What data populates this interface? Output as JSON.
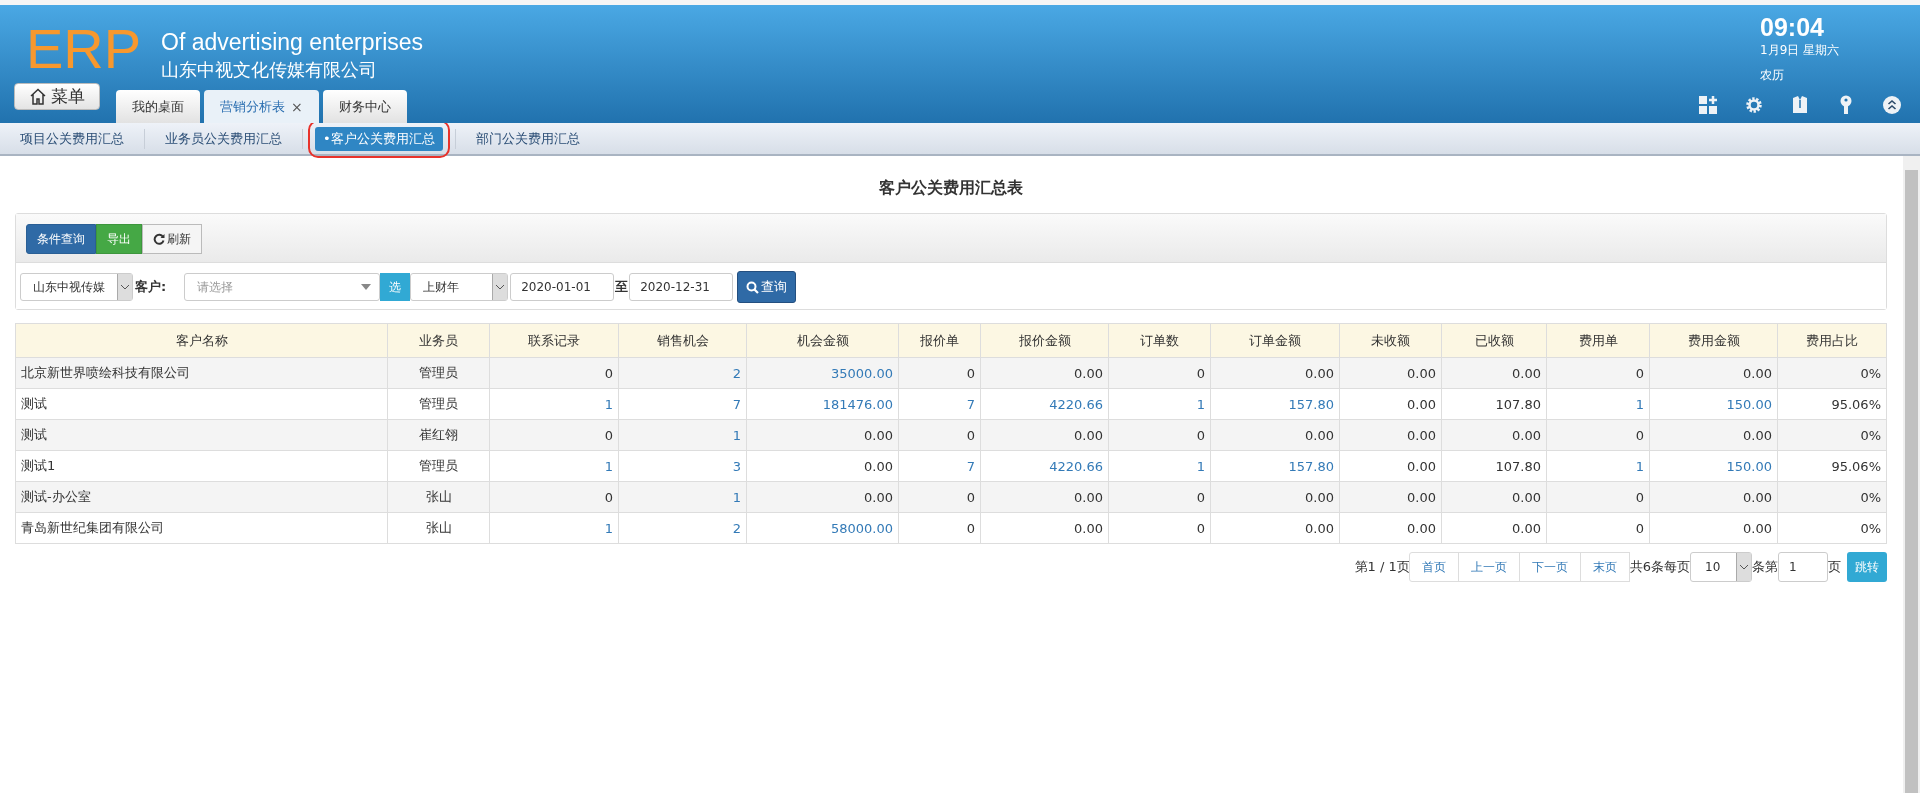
{
  "header": {
    "logo": "ERP",
    "title": "Of advertising enterprises",
    "company": "山东中视文化传媒有限公司",
    "menu_button": "菜单",
    "time": "09:04",
    "date": "1月9日 星期六",
    "lunar": "农历"
  },
  "tabs": [
    {
      "label": "我的桌面",
      "selected": false,
      "closable": false
    },
    {
      "label": "营销分析表",
      "selected": true,
      "closable": true,
      "close": "×"
    },
    {
      "label": "财务中心",
      "selected": false,
      "closable": false
    }
  ],
  "subtabs": [
    {
      "label": "项目公关费用汇总",
      "selected": false
    },
    {
      "label": "业务员公关费用汇总",
      "selected": false
    },
    {
      "label": "•客户公关费用汇总",
      "selected": true
    },
    {
      "label": "部门公关费用汇总",
      "selected": false
    }
  ],
  "page_title": "客户公关费用汇总表",
  "toolbar": [
    {
      "label": "条件查询",
      "kind": "primary"
    },
    {
      "label": "导出",
      "kind": "success"
    },
    {
      "label": "刷新",
      "kind": "refresh"
    }
  ],
  "filters": {
    "company": "山东中视传媒",
    "customer_label": "客户:",
    "customer_placeholder": "请选择",
    "pick_button": "选",
    "period": "上财年",
    "date_from": "2020-01-01",
    "to_label": "至",
    "date_to": "2020-12-31",
    "query_button": "查询"
  },
  "table": {
    "columns": [
      "客户名称",
      "业务员",
      "联系记录",
      "销售机会",
      "机会金额",
      "报价单",
      "报价金额",
      "订单数",
      "订单金额",
      "未收额",
      "已收额",
      "费用单",
      "费用金额",
      "费用占比"
    ],
    "rows": [
      [
        {
          "text": "北京新世界喷绘科技有限公司",
          "link": false
        },
        {
          "text": "管理员",
          "link": false
        },
        {
          "text": "0",
          "link": false
        },
        {
          "text": "2",
          "link": true
        },
        {
          "text": "35000.00",
          "link": true
        },
        {
          "text": "0",
          "link": false
        },
        {
          "text": "0.00",
          "link": false
        },
        {
          "text": "0",
          "link": false
        },
        {
          "text": "0.00",
          "link": false
        },
        {
          "text": "0.00",
          "link": false
        },
        {
          "text": "0.00",
          "link": false
        },
        {
          "text": "0",
          "link": false
        },
        {
          "text": "0.00",
          "link": false
        },
        {
          "text": "0%",
          "link": false
        }
      ],
      [
        {
          "text": "测试",
          "link": false
        },
        {
          "text": "管理员",
          "link": false
        },
        {
          "text": "1",
          "link": true
        },
        {
          "text": "7",
          "link": true
        },
        {
          "text": "181476.00",
          "link": true
        },
        {
          "text": "7",
          "link": true
        },
        {
          "text": "4220.66",
          "link": true
        },
        {
          "text": "1",
          "link": true
        },
        {
          "text": "157.80",
          "link": true
        },
        {
          "text": "0.00",
          "link": false
        },
        {
          "text": "107.80",
          "link": false
        },
        {
          "text": "1",
          "link": true
        },
        {
          "text": "150.00",
          "link": true
        },
        {
          "text": "95.06%",
          "link": false
        }
      ],
      [
        {
          "text": "测试",
          "link": false
        },
        {
          "text": "崔红翎",
          "link": false
        },
        {
          "text": "0",
          "link": false
        },
        {
          "text": "1",
          "link": true
        },
        {
          "text": "0.00",
          "link": false
        },
        {
          "text": "0",
          "link": false
        },
        {
          "text": "0.00",
          "link": false
        },
        {
          "text": "0",
          "link": false
        },
        {
          "text": "0.00",
          "link": false
        },
        {
          "text": "0.00",
          "link": false
        },
        {
          "text": "0.00",
          "link": false
        },
        {
          "text": "0",
          "link": false
        },
        {
          "text": "0.00",
          "link": false
        },
        {
          "text": "0%",
          "link": false
        }
      ],
      [
        {
          "text": "测试1",
          "link": false
        },
        {
          "text": "管理员",
          "link": false
        },
        {
          "text": "1",
          "link": true
        },
        {
          "text": "3",
          "link": true
        },
        {
          "text": "0.00",
          "link": false
        },
        {
          "text": "7",
          "link": true
        },
        {
          "text": "4220.66",
          "link": true
        },
        {
          "text": "1",
          "link": true
        },
        {
          "text": "157.80",
          "link": true
        },
        {
          "text": "0.00",
          "link": false
        },
        {
          "text": "107.80",
          "link": false
        },
        {
          "text": "1",
          "link": true
        },
        {
          "text": "150.00",
          "link": true
        },
        {
          "text": "95.06%",
          "link": false
        }
      ],
      [
        {
          "text": "测试-办公室",
          "link": false
        },
        {
          "text": "张山",
          "link": false
        },
        {
          "text": "0",
          "link": false
        },
        {
          "text": "1",
          "link": true
        },
        {
          "text": "0.00",
          "link": false
        },
        {
          "text": "0",
          "link": false
        },
        {
          "text": "0.00",
          "link": false
        },
        {
          "text": "0",
          "link": false
        },
        {
          "text": "0.00",
          "link": false
        },
        {
          "text": "0.00",
          "link": false
        },
        {
          "text": "0.00",
          "link": false
        },
        {
          "text": "0",
          "link": false
        },
        {
          "text": "0.00",
          "link": false
        },
        {
          "text": "0%",
          "link": false
        }
      ],
      [
        {
          "text": "青岛新世纪集团有限公司",
          "link": false
        },
        {
          "text": "张山",
          "link": false
        },
        {
          "text": "1",
          "link": true
        },
        {
          "text": "2",
          "link": true
        },
        {
          "text": "58000.00",
          "link": true
        },
        {
          "text": "0",
          "link": false
        },
        {
          "text": "0.00",
          "link": false
        },
        {
          "text": "0",
          "link": false
        },
        {
          "text": "0.00",
          "link": false
        },
        {
          "text": "0.00",
          "link": false
        },
        {
          "text": "0.00",
          "link": false
        },
        {
          "text": "0",
          "link": false
        },
        {
          "text": "0.00",
          "link": false
        },
        {
          "text": "0%",
          "link": false
        }
      ]
    ]
  },
  "pagination": {
    "page_info": "第1 / 1页",
    "buttons": [
      "首页",
      "上一页",
      "下一页",
      "末页"
    ],
    "total": "共6条每页",
    "page_size": "10",
    "rows_label": "条第",
    "page_input": "1",
    "page_label": "页",
    "go_button": "跳转"
  }
}
